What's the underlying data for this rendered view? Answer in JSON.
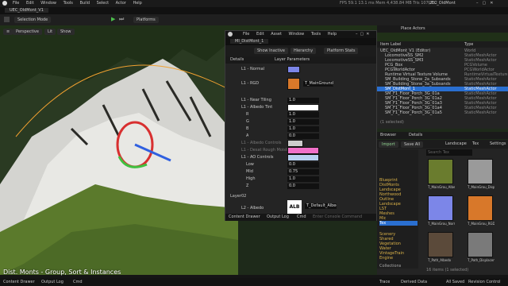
{
  "title_bar": {
    "project_name": "UEC_OldMont",
    "stats": {
      "fps": "FPS 59.1",
      "ms": "13.1 ms",
      "mem": "Mem 4,438.84 MB",
      "tris": "Tris 107,212"
    }
  },
  "main_menu": [
    "File",
    "Edit",
    "Window",
    "Tools",
    "Build",
    "Select",
    "Actor",
    "Help"
  ],
  "level_tab": "UEC_OldMont_V1",
  "toolbar": {
    "mode": "Selection Mode",
    "platforms": "Platforms"
  },
  "viewport": {
    "perspective": "Perspective",
    "lit": "Lit",
    "show": "Show",
    "caption": "Dist. Monts - Group, Sort & Instances"
  },
  "material_editor": {
    "menu": [
      "File",
      "Edit",
      "Asset",
      "Window",
      "Tools",
      "Help"
    ],
    "tab": "MI_DistMont_1",
    "toolbar": [
      "Show Inactive",
      "Hierarchy",
      "Platform Stats"
    ],
    "tabs": [
      "Details",
      "Layer Parameters"
    ],
    "rows": [
      {
        "label": "L1 - Normal"
      },
      {
        "label": "L1 - RGD",
        "value": "T_MainGround_RGD"
      },
      {
        "label": "L1 - Near Tiling",
        "value": "1.0"
      },
      {
        "label": "L1 - Albedo Tint"
      },
      {
        "label": "R",
        "value": "1.0"
      },
      {
        "label": "G",
        "value": "1.0"
      },
      {
        "label": "B",
        "value": "1.0"
      },
      {
        "label": "A",
        "value": "0.0"
      },
      {
        "label": "L1 - Albedo Controls"
      },
      {
        "label": "L1 - Desat Rough Moist"
      },
      {
        "label": "L1 - AO Controls"
      },
      {
        "label": "Low",
        "value": "0.0"
      },
      {
        "label": "Mid",
        "value": "0.75"
      },
      {
        "label": "High",
        "value": "1.0"
      },
      {
        "label": "Z",
        "value": "0.0"
      }
    ],
    "section": "Layer02",
    "layer_label": "L2 - Albedo",
    "layer_texture": "T_Default_Albedo",
    "bottom": [
      "Content Drawer",
      "Output Log",
      "Cmd"
    ],
    "cmd_placeholder": "Enter Console Command"
  },
  "place_actors": "Place Actors",
  "outliner": {
    "columns": [
      "Item Label",
      "Type"
    ],
    "rows": [
      {
        "label": "UEC_OldMont_V1 (Editor)",
        "type": "World"
      },
      {
        "label": "LocomotiveSS_SM2",
        "type": "StaticMeshActor"
      },
      {
        "label": "LocomotiveSS_SM3",
        "type": "StaticMeshActor"
      },
      {
        "label": "PCG_Box",
        "type": "PCGVolume"
      },
      {
        "label": "PCGWorldActor",
        "type": "PCGWorldActor"
      },
      {
        "label": "Runtime Virtual Texture Volume",
        "type": "RuntimeVirtualTexture"
      },
      {
        "label": "SM_Building_Stone_2a_Subsands",
        "type": "StaticMeshActor"
      },
      {
        "label": "SM_Building_Stone_3a_Subsands",
        "type": "StaticMeshActor"
      },
      {
        "label": "SM_DistMont_1",
        "type": "StaticMeshActor",
        "selected": true
      },
      {
        "label": "SM_F1_Floor_Porch_3G_01a",
        "type": "StaticMeshActor"
      },
      {
        "label": "SM_F1_Floor_Porch_3G_01a2",
        "type": "StaticMeshActor"
      },
      {
        "label": "SM_F1_Floor_Porch_3G_01a3",
        "type": "StaticMeshActor"
      },
      {
        "label": "SM_F1_Floor_Porch_3G_01a4",
        "type": "StaticMeshActor"
      },
      {
        "label": "SM_F1_Floor_Porch_3G_01a5",
        "type": "StaticMeshActor"
      }
    ],
    "count": "(1 selected)"
  },
  "browser": {
    "tabs": [
      "Browser",
      "Details"
    ],
    "import": "Import",
    "save_all": "Save All",
    "path": [
      "Landscape",
      "Tex"
    ],
    "settings": "Settings",
    "folders": [
      "Blueprint",
      "DistMonts",
      "Landscape",
      "Northwood",
      "Outline",
      "Landscape",
      "LST",
      "Meshes",
      "Mic",
      "Tex"
    ],
    "lower_folders": [
      "Scenery",
      "Shared",
      "Vegetation",
      "Water",
      "VintageTrain",
      "Engine"
    ],
    "assets": [
      {
        "name": "T_MainGrou_Albedo",
        "color": "#6a7c2e"
      },
      {
        "name": "T_MainGrou_Displacement",
        "color": "#9a9a9a"
      },
      {
        "name": "T_MainGrou_Normal",
        "color": "#7c86e8"
      },
      {
        "name": "T_MainGrou_RGD",
        "color": "#d8782a"
      },
      {
        "name": "T_Path_Albedo",
        "color": "#5b4a3a"
      },
      {
        "name": "T_Path_Displacement",
        "color": "#7a7a7a"
      }
    ],
    "item_count": "16 items (1 selected)",
    "search_placeholder": "Search Tex",
    "collections": "Collections"
  },
  "status_bar": {
    "left": [
      "Content Drawer",
      "Output Log",
      "Cmd"
    ],
    "right": [
      "Trace",
      "Derived Data",
      "All Saved",
      "Revision Control"
    ]
  }
}
